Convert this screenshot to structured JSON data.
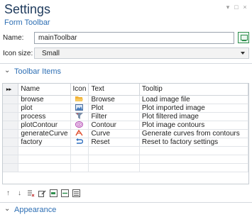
{
  "window": {
    "title": "Settings",
    "subtitle": "Form Toolbar"
  },
  "window_controls": [
    "▾",
    "□",
    "×"
  ],
  "name_field": {
    "label": "Name:",
    "value": "mainToolbar"
  },
  "icon_size": {
    "label": "Icon size:",
    "value": "Small"
  },
  "sections": {
    "toolbar_items": "Toolbar Items",
    "appearance": "Appearance"
  },
  "grid": {
    "corner": "▸▸",
    "columns": [
      "Name",
      "Icon",
      "Text",
      "Tooltip"
    ],
    "rows": [
      {
        "name": "browse",
        "icon": "folder-open-icon",
        "text": "Browse",
        "tooltip": "Load image file"
      },
      {
        "name": "plot",
        "icon": "image-plot-icon",
        "text": "Plot",
        "tooltip": "Plot imported image"
      },
      {
        "name": "process",
        "icon": "filter-icon",
        "text": "Filter",
        "tooltip": "Plot filtered image"
      },
      {
        "name": "plotContour",
        "icon": "contour-icon",
        "text": "Contour",
        "tooltip": "Plot image contours"
      },
      {
        "name": "generateCurve",
        "icon": "curve-icon",
        "text": "Curve",
        "tooltip": "Generate curves from contours"
      },
      {
        "name": "factory",
        "icon": "reset-icon",
        "text": "Reset",
        "tooltip": "Reset to factory settings"
      }
    ],
    "empty_rows": 4
  },
  "toolbar_icons": [
    "move-up-icon",
    "move-down-icon",
    "delete-list-icon",
    "edit-icon",
    "add-item-icon",
    "add-separator-icon",
    "add-list-icon"
  ]
}
